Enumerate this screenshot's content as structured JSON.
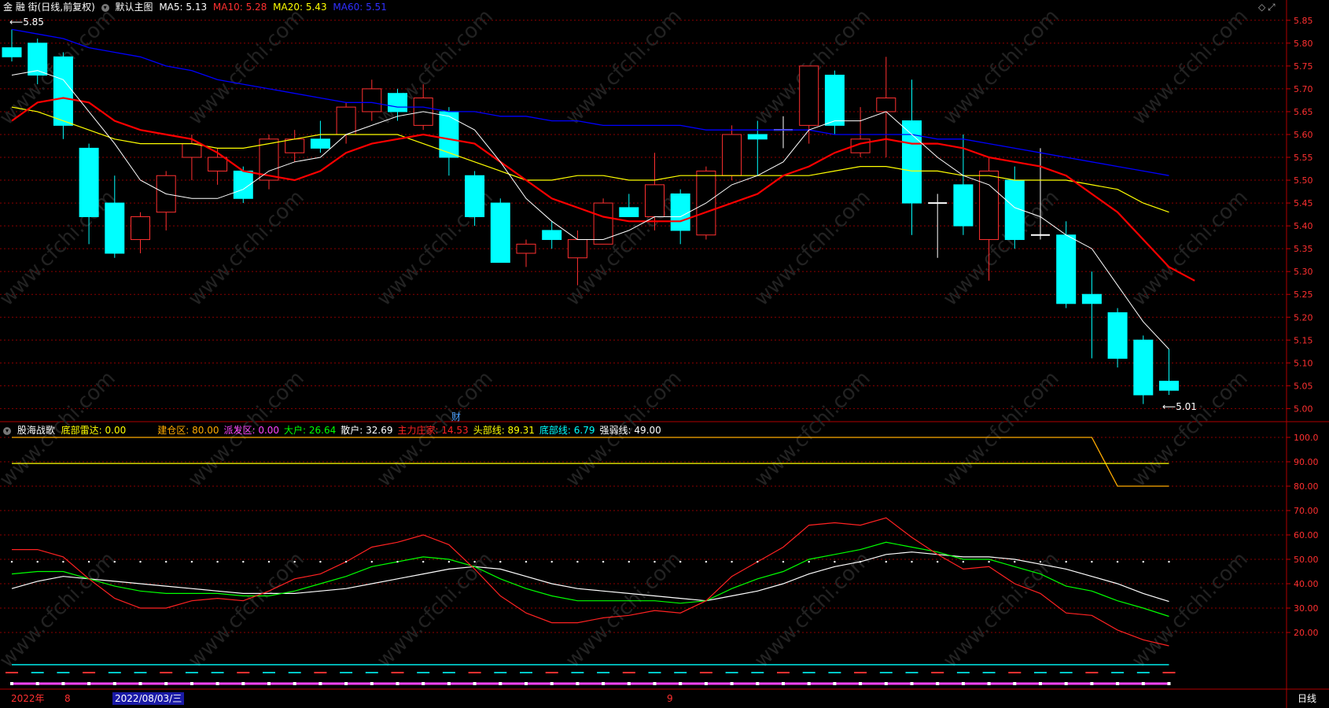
{
  "header": {
    "stock": "金 融 街(日线,前复权)",
    "main_chart": "默认主图",
    "ma5": "MA5: 5.13",
    "ma10": "MA10: 5.28",
    "ma20": "MA20: 5.43",
    "ma60": "MA60: 5.51"
  },
  "indicator": {
    "name": "股海战歌",
    "items": [
      {
        "text": "底部雷达: 0.00",
        "color": "#ffff00"
      },
      {
        "text": "建仓区: 80.00",
        "color": "#ffaa00"
      },
      {
        "text": "派发区: 0.00",
        "color": "#ff44ff"
      },
      {
        "text": "大户: 26.64",
        "color": "#00ff00"
      },
      {
        "text": "散户: 32.69",
        "color": "#ffffff"
      },
      {
        "text": "主力庄家: 14.53",
        "color": "#ff2222"
      },
      {
        "text": "头部线: 89.31",
        "color": "#ffff00"
      },
      {
        "text": "底部线: 6.79",
        "color": "#00ffff"
      },
      {
        "text": "强弱线: 49.00",
        "color": "#ffffff"
      }
    ]
  },
  "annotations": {
    "high_label": "5.85",
    "low_label": "5.01",
    "cai": "财"
  },
  "footer": {
    "year": "2022年",
    "month8": "8",
    "date_sel": "2022/08/03/三",
    "month9": "9",
    "period": "日线"
  },
  "price_axis": [
    "5.85",
    "5.80",
    "5.75",
    "5.70",
    "5.65",
    "5.60",
    "5.55",
    "5.50",
    "5.45",
    "5.40",
    "5.35",
    "5.30",
    "5.25",
    "5.20",
    "5.15",
    "5.10",
    "5.05",
    "5.00"
  ],
  "ind_axis": [
    "100.0",
    "90.00",
    "80.00",
    "70.00",
    "60.00",
    "50.00",
    "40.00",
    "30.00",
    "20.00"
  ],
  "watermark": "www.cfchi.com",
  "colors": {
    "up": "#ff3030",
    "down": "#00ffff",
    "ma5": "#ffffff",
    "ma10": "#ff0000",
    "ma20": "#ffff00",
    "ma60": "#0000ff",
    "grid": "#8b0000"
  },
  "chart_data": {
    "type": "candlestick",
    "candles": [
      [
        5.79,
        5.83,
        5.76,
        5.77
      ],
      [
        5.8,
        5.81,
        5.71,
        5.73
      ],
      [
        5.77,
        5.78,
        5.59,
        5.62
      ],
      [
        5.57,
        5.58,
        5.36,
        5.42
      ],
      [
        5.45,
        5.51,
        5.33,
        5.34
      ],
      [
        5.37,
        5.43,
        5.34,
        5.42
      ],
      [
        5.43,
        5.52,
        5.39,
        5.51
      ],
      [
        5.55,
        5.6,
        5.5,
        5.58
      ],
      [
        5.52,
        5.57,
        5.49,
        5.55
      ],
      [
        5.52,
        5.53,
        5.45,
        5.46
      ],
      [
        5.5,
        5.6,
        5.48,
        5.59
      ],
      [
        5.56,
        5.61,
        5.54,
        5.59
      ],
      [
        5.59,
        5.63,
        5.56,
        5.57
      ],
      [
        5.6,
        5.67,
        5.58,
        5.66
      ],
      [
        5.65,
        5.72,
        5.63,
        5.7
      ],
      [
        5.69,
        5.7,
        5.63,
        5.65
      ],
      [
        5.62,
        5.71,
        5.61,
        5.68
      ],
      [
        5.65,
        5.66,
        5.51,
        5.55
      ],
      [
        5.51,
        5.52,
        5.4,
        5.42
      ],
      [
        5.45,
        5.46,
        5.32,
        5.32
      ],
      [
        5.34,
        5.37,
        5.31,
        5.36
      ],
      [
        5.39,
        5.41,
        5.35,
        5.37
      ],
      [
        5.33,
        5.39,
        5.27,
        5.37
      ],
      [
        5.36,
        5.46,
        5.36,
        5.45
      ],
      [
        5.44,
        5.47,
        5.42,
        5.42
      ],
      [
        5.42,
        5.56,
        5.39,
        5.49
      ],
      [
        5.47,
        5.48,
        5.36,
        5.39
      ],
      [
        5.38,
        5.53,
        5.37,
        5.52
      ],
      [
        5.51,
        5.62,
        5.5,
        5.6
      ],
      [
        5.6,
        5.63,
        5.51,
        5.59
      ],
      [
        5.61,
        5.64,
        5.57,
        5.61
      ],
      [
        5.62,
        5.75,
        5.58,
        5.75
      ],
      [
        5.73,
        5.74,
        5.6,
        5.62
      ],
      [
        5.56,
        5.66,
        5.55,
        5.59
      ],
      [
        5.65,
        5.77,
        5.55,
        5.68
      ],
      [
        5.63,
        5.72,
        5.38,
        5.45
      ],
      [
        5.45,
        5.47,
        5.33,
        5.45
      ],
      [
        5.49,
        5.6,
        5.38,
        5.4
      ],
      [
        5.37,
        5.55,
        5.28,
        5.52
      ],
      [
        5.5,
        5.53,
        5.35,
        5.37
      ],
      [
        5.38,
        5.57,
        5.37,
        5.38
      ],
      [
        5.38,
        5.41,
        5.22,
        5.23
      ],
      [
        5.25,
        5.3,
        5.11,
        5.23
      ],
      [
        5.21,
        5.22,
        5.09,
        5.11
      ],
      [
        5.15,
        5.16,
        5.01,
        5.03
      ],
      [
        5.06,
        5.13,
        5.03,
        5.04
      ]
    ],
    "ma5": [
      5.73,
      5.74,
      5.72,
      5.65,
      5.58,
      5.5,
      5.47,
      5.46,
      5.46,
      5.48,
      5.52,
      5.54,
      5.55,
      5.6,
      5.62,
      5.64,
      5.65,
      5.64,
      5.61,
      5.54,
      5.46,
      5.41,
      5.37,
      5.37,
      5.39,
      5.42,
      5.42,
      5.45,
      5.49,
      5.51,
      5.54,
      5.61,
      5.63,
      5.63,
      5.65,
      5.6,
      5.55,
      5.51,
      5.49,
      5.44,
      5.42,
      5.38,
      5.35,
      5.27,
      5.19,
      5.13
    ],
    "ma10": [
      5.63,
      5.67,
      5.68,
      5.67,
      5.63,
      5.61,
      5.6,
      5.59,
      5.56,
      5.52,
      5.51,
      5.5,
      5.52,
      5.56,
      5.58,
      5.59,
      5.6,
      5.59,
      5.58,
      5.54,
      5.5,
      5.46,
      5.44,
      5.42,
      5.41,
      5.41,
      5.41,
      5.43,
      5.45,
      5.47,
      5.51,
      5.53,
      5.56,
      5.58,
      5.59,
      5.58,
      5.58,
      5.57,
      5.55,
      5.54,
      5.53,
      5.51,
      5.47,
      5.43,
      5.37,
      5.31,
      5.28
    ],
    "ma20": [
      5.66,
      5.65,
      5.63,
      5.61,
      5.59,
      5.58,
      5.58,
      5.58,
      5.57,
      5.57,
      5.58,
      5.59,
      5.6,
      5.6,
      5.6,
      5.6,
      5.58,
      5.56,
      5.54,
      5.52,
      5.5,
      5.5,
      5.51,
      5.51,
      5.5,
      5.5,
      5.51,
      5.51,
      5.51,
      5.51,
      5.51,
      5.51,
      5.52,
      5.53,
      5.53,
      5.52,
      5.52,
      5.51,
      5.51,
      5.5,
      5.5,
      5.5,
      5.49,
      5.48,
      5.45,
      5.43
    ],
    "ma60": [
      5.83,
      5.82,
      5.81,
      5.79,
      5.78,
      5.77,
      5.75,
      5.74,
      5.72,
      5.71,
      5.7,
      5.69,
      5.68,
      5.67,
      5.67,
      5.66,
      5.66,
      5.65,
      5.65,
      5.64,
      5.64,
      5.63,
      5.63,
      5.62,
      5.62,
      5.62,
      5.62,
      5.61,
      5.61,
      5.61,
      5.61,
      5.61,
      5.6,
      5.6,
      5.6,
      5.6,
      5.59,
      5.59,
      5.58,
      5.57,
      5.56,
      5.55,
      5.54,
      5.53,
      5.52,
      5.51
    ],
    "ind_zhuli": [
      54,
      54,
      51,
      42,
      34,
      30,
      30,
      33,
      34,
      33,
      37,
      42,
      44,
      49,
      55,
      57,
      60,
      56,
      46,
      35,
      28,
      24,
      24,
      26,
      27,
      29,
      28,
      33,
      43,
      49,
      55,
      64,
      65,
      64,
      67,
      59,
      52,
      46,
      47,
      40,
      36,
      28,
      27,
      21,
      17,
      14.5
    ],
    "ind_dahu": [
      44,
      45,
      45,
      42,
      39,
      37,
      36,
      36,
      36,
      35,
      35,
      37,
      40,
      43,
      47,
      49,
      51,
      50,
      47,
      42,
      38,
      35,
      33,
      33,
      33,
      33,
      32,
      33,
      38,
      42,
      45,
      50,
      52,
      54,
      57,
      55,
      53,
      50,
      50,
      47,
      44,
      39,
      37,
      33,
      30,
      26.6
    ],
    "ind_sanhu": [
      38,
      41,
      43,
      42,
      41,
      40,
      39,
      38,
      37,
      36,
      36,
      36,
      37,
      38,
      40,
      42,
      44,
      46,
      47,
      46,
      43,
      40,
      38,
      37,
      36,
      35,
      34,
      33,
      35,
      37,
      40,
      44,
      47,
      49,
      52,
      53,
      52,
      51,
      51,
      50,
      48,
      46,
      43,
      40,
      36,
      32.7
    ],
    "ind_head": 89.31,
    "ind_bottom": 6.79,
    "ind_build": [
      100,
      100,
      100,
      100,
      100,
      100,
      100,
      100,
      100,
      100,
      100,
      100,
      100,
      100,
      100,
      100,
      100,
      100,
      100,
      100,
      100,
      100,
      100,
      100,
      100,
      100,
      100,
      100,
      100,
      100,
      100,
      100,
      100,
      100,
      100,
      100,
      100,
      100,
      100,
      100,
      100,
      100,
      100,
      80,
      80,
      80
    ],
    "ind_strong": 49
  }
}
